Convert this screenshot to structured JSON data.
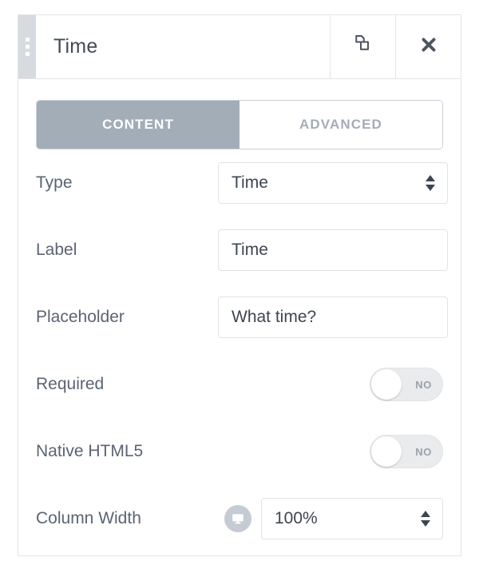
{
  "panel": {
    "header": {
      "title": "Time",
      "grip_icon": "drag-handle-icon",
      "duplicate_icon": "duplicate-icon",
      "close_icon": "close-icon"
    },
    "tabs": [
      {
        "label": "CONTENT",
        "active": true
      },
      {
        "label": "ADVANCED",
        "active": false
      }
    ],
    "rows": [
      {
        "label": "Type",
        "control": "select",
        "value": "Time"
      },
      {
        "label": "Label",
        "control": "text",
        "value": "Time"
      },
      {
        "label": "Placeholder",
        "control": "text",
        "value": "What time?"
      },
      {
        "label": "Required",
        "control": "toggle",
        "value": "NO"
      },
      {
        "label": "Native HTML5",
        "control": "toggle",
        "value": "NO"
      },
      {
        "label": "Column Width",
        "control": "select",
        "value": "100%",
        "device_icon": "desktop-icon"
      }
    ]
  },
  "colors": {
    "tab_active_bg": "#a3adb8",
    "tab_inactive_text": "#a3adb8",
    "label_text": "#5a6472",
    "title_text": "#424a56",
    "grip_bg": "#d7dbdf",
    "toggle_track": "#e9ebed",
    "device_badge": "#c5cbd2",
    "border": "#e2e5e8"
  }
}
